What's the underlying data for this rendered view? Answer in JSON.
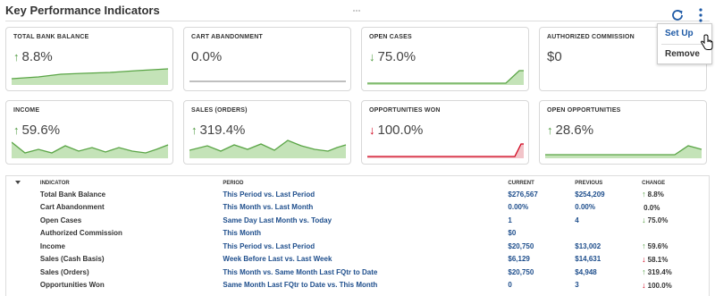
{
  "title": "Key Performance Indicators",
  "menu": {
    "items": [
      "Set Up",
      "Remove"
    ]
  },
  "colors": {
    "green": "#4f9a3f",
    "red": "#d0021b",
    "link": "#1e4e8c",
    "gray": "#999999"
  },
  "tiles": [
    {
      "name": "TOTAL BANK BALANCE",
      "arrow": "↑",
      "value": "8.8%"
    },
    {
      "name": "CART ABANDONMENT",
      "arrow": "",
      "value": "0.0%"
    },
    {
      "name": "OPEN CASES",
      "arrow": "↓",
      "value": "75.0%"
    },
    {
      "name": "AUTHORIZED COMMISSION",
      "arrow": "",
      "value": "$0"
    },
    {
      "name": "INCOME",
      "arrow": "↑",
      "value": "59.6%"
    },
    {
      "name": "SALES (ORDERS)",
      "arrow": "↑",
      "value": "319.4%"
    },
    {
      "name": "OPPORTUNITIES WON",
      "arrow": "↓",
      "value": "100.0%"
    },
    {
      "name": "OPEN OPPORTUNITIES",
      "arrow": "↑",
      "value": "28.6%"
    }
  ],
  "table": {
    "headers": {
      "indicator": "INDICATOR",
      "period": "PERIOD",
      "current": "CURRENT",
      "previous": "PREVIOUS",
      "change": "CHANGE"
    },
    "rows": [
      {
        "indicator": "Total Bank Balance",
        "period": "This Period vs. Last Period",
        "current": "$276,567",
        "previous": "$254,209",
        "arrow": "↑",
        "change": "8.8%"
      },
      {
        "indicator": "Cart Abandonment",
        "period": "This Month vs. Last Month",
        "current": "0.00%",
        "previous": "0.00%",
        "arrow": "",
        "change": "0.0%"
      },
      {
        "indicator": "Open Cases",
        "period": "Same Day Last Month vs. Today",
        "current": "1",
        "previous": "4",
        "arrow": "↓",
        "change": "75.0%"
      },
      {
        "indicator": "Authorized Commission",
        "period": "This Month",
        "current": "$0",
        "previous": "",
        "arrow": "",
        "change": ""
      },
      {
        "indicator": "Income",
        "period": "This Period vs. Last Period",
        "current": "$20,750",
        "previous": "$13,002",
        "arrow": "↑",
        "change": "59.6%"
      },
      {
        "indicator": "Sales (Cash Basis)",
        "period": "Week Before Last vs. Last Week",
        "current": "$6,129",
        "previous": "$14,631",
        "arrow": "↓",
        "change": "58.1%"
      },
      {
        "indicator": "Sales (Orders)",
        "period": "This Month vs. Same Month Last FQtr to Date",
        "current": "$20,750",
        "previous": "$4,948",
        "arrow": "↑",
        "change": "319.4%"
      },
      {
        "indicator": "Opportunities Won",
        "period": "Same Month Last FQtr to Date vs. This Month",
        "current": "0",
        "previous": "3",
        "arrow": "↓",
        "change": "100.0%"
      }
    ]
  }
}
